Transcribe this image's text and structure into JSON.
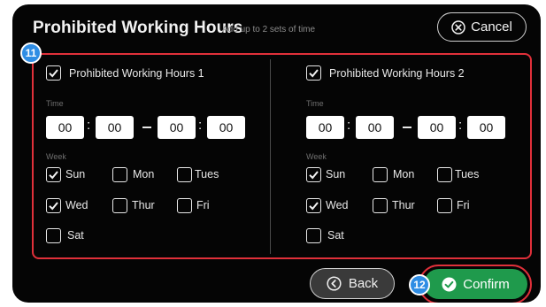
{
  "header": {
    "title": "Prohibited Working Hours",
    "subtitle": "Add up to 2 sets of time",
    "cancel_label": "Cancel"
  },
  "callouts": {
    "panel": "11",
    "confirm": "12"
  },
  "sets": [
    {
      "label": "Prohibited Working Hours 1",
      "enabled": true,
      "time_label": "Time",
      "start_hour": "00",
      "start_minute": "00",
      "end_hour": "00",
      "end_minute": "00",
      "week_label": "Week",
      "days": [
        {
          "label": "Sun",
          "checked": true
        },
        {
          "label": "Mon",
          "checked": false
        },
        {
          "label": "Tues",
          "checked": false
        },
        {
          "label": "Wed",
          "checked": true
        },
        {
          "label": "Thur",
          "checked": false
        },
        {
          "label": "Fri",
          "checked": false
        },
        {
          "label": "Sat",
          "checked": false
        }
      ]
    },
    {
      "label": "Prohibited Working Hours 2",
      "enabled": true,
      "time_label": "Time",
      "start_hour": "00",
      "start_minute": "00",
      "end_hour": "00",
      "end_minute": "00",
      "week_label": "Week",
      "days": [
        {
          "label": "Sun",
          "checked": true
        },
        {
          "label": "Mon",
          "checked": false
        },
        {
          "label": "Tues",
          "checked": false
        },
        {
          "label": "Wed",
          "checked": true
        },
        {
          "label": "Thur",
          "checked": false
        },
        {
          "label": "Fri",
          "checked": false
        },
        {
          "label": "Sat",
          "checked": false
        }
      ]
    }
  ],
  "footer": {
    "back_label": "Back",
    "confirm_label": "Confirm"
  },
  "colors": {
    "panel_bg": "#050505",
    "highlight": "#e0303a",
    "callout": "#2f8de4",
    "confirm": "#1f9a4c"
  }
}
